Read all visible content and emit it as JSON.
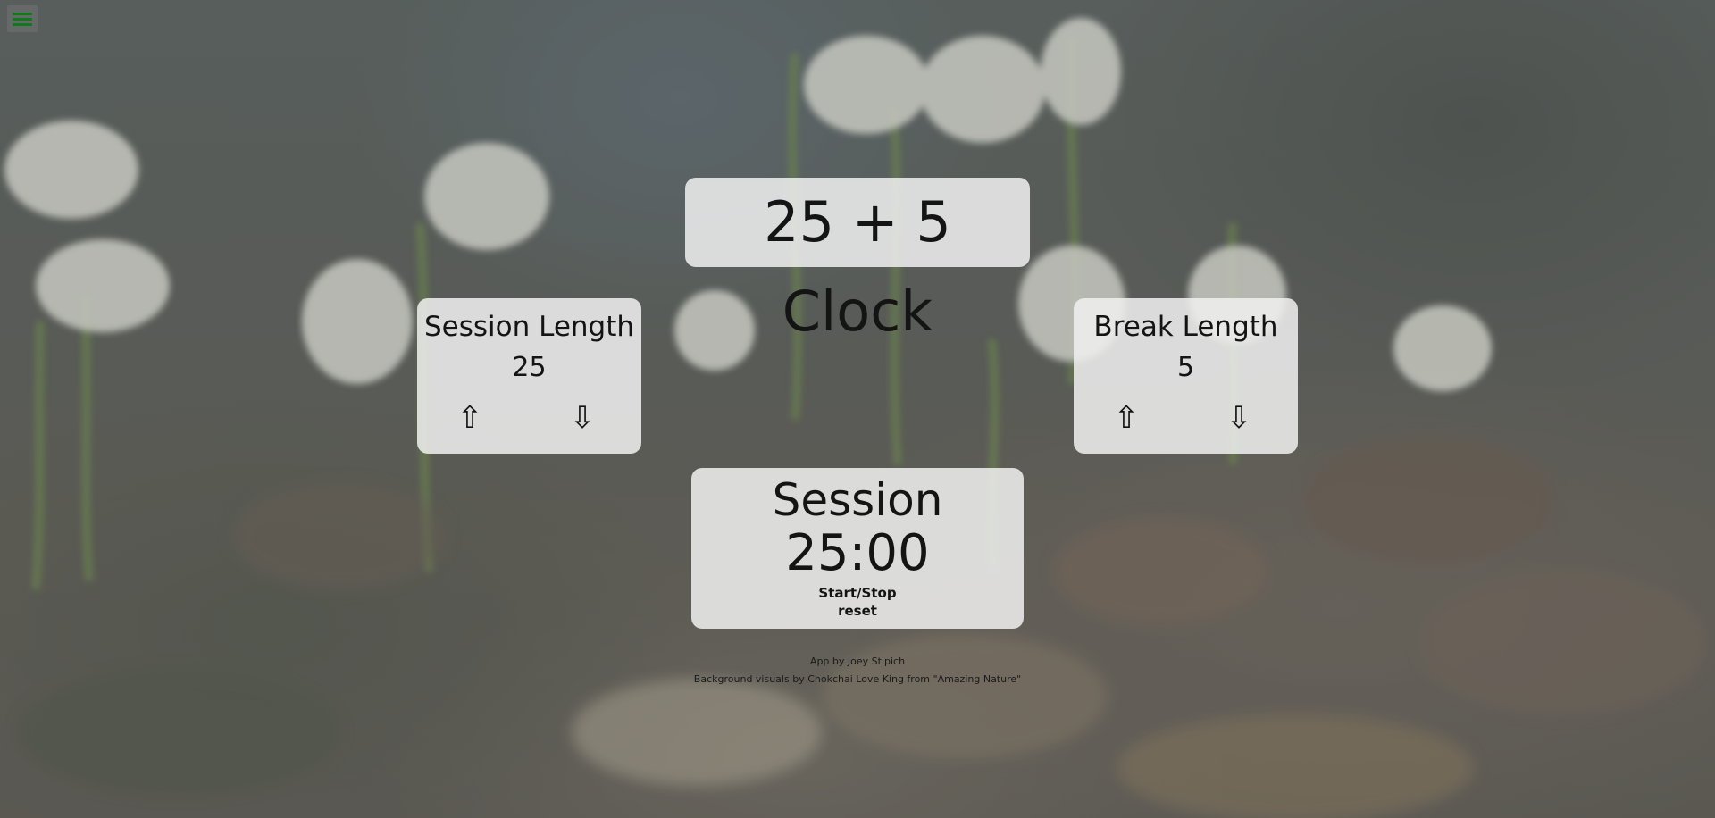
{
  "menu": {
    "icon": "hamburger-menu-icon",
    "color": "#0e7a1a"
  },
  "app": {
    "title": "25 + 5 Clock"
  },
  "session_length": {
    "label": "Session Length",
    "value": "25",
    "increment_glyph": "⇧",
    "decrement_glyph": "⇩"
  },
  "break_length": {
    "label": "Break Length",
    "value": "5",
    "increment_glyph": "⇧",
    "decrement_glyph": "⇩"
  },
  "timer": {
    "label": "Session",
    "time": "25:00",
    "start_stop_label": "Start/Stop",
    "reset_label": "reset"
  },
  "credits": {
    "author": "App by Joey Stipich",
    "background": "Background visuals by Chokchai Love King from \"Amazing Nature\""
  }
}
